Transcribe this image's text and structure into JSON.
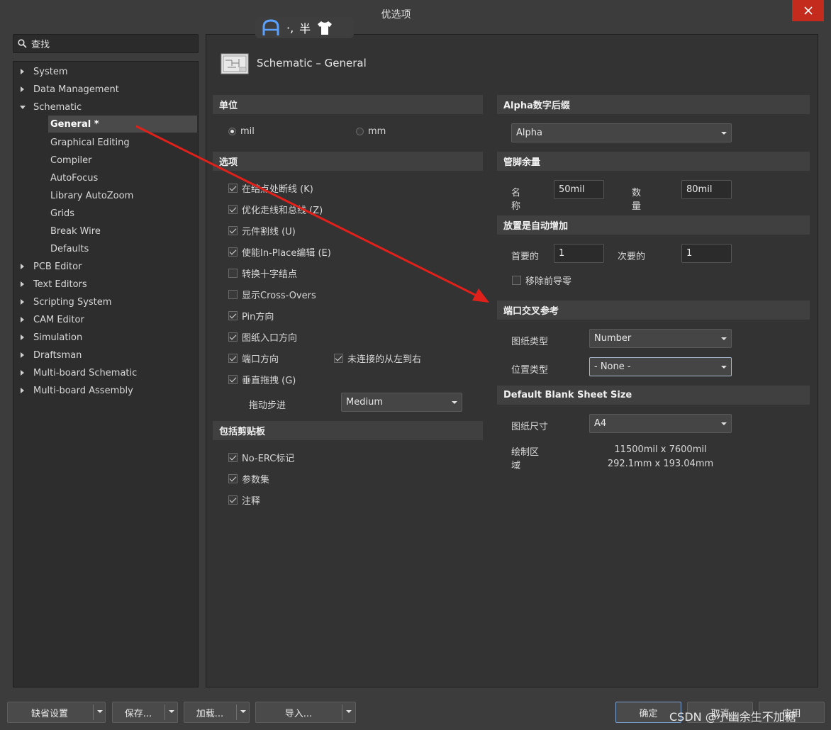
{
  "window": {
    "title": "优选项"
  },
  "ime": {
    "text1": "·,",
    "text2": "半"
  },
  "search": {
    "placeholder": "查找"
  },
  "tree": {
    "items": [
      {
        "label": "System"
      },
      {
        "label": "Data Management"
      },
      {
        "label": "Schematic"
      },
      {
        "label": "General *"
      },
      {
        "label": "Graphical Editing"
      },
      {
        "label": "Compiler"
      },
      {
        "label": "AutoFocus"
      },
      {
        "label": "Library AutoZoom"
      },
      {
        "label": "Grids"
      },
      {
        "label": "Break Wire"
      },
      {
        "label": "Defaults"
      },
      {
        "label": "PCB Editor"
      },
      {
        "label": "Text Editors"
      },
      {
        "label": "Scripting System"
      },
      {
        "label": "CAM Editor"
      },
      {
        "label": "Simulation"
      },
      {
        "label": "Draftsman"
      },
      {
        "label": "Multi-board Schematic"
      },
      {
        "label": "Multi-board Assembly"
      }
    ]
  },
  "page": {
    "title": "Schematic – General"
  },
  "units": {
    "header": "单位",
    "mil": "mil",
    "mm": "mm",
    "selected": "mil"
  },
  "options": {
    "header": "选项",
    "items": [
      {
        "label": "在结点处断线 (K)",
        "checked": true
      },
      {
        "label": "优化走线和总线 (Z)",
        "checked": true
      },
      {
        "label": "元件割线 (U)",
        "checked": true
      },
      {
        "label": "使能In-Place编辑 (E)",
        "checked": true
      },
      {
        "label": "转换十字结点",
        "checked": false
      },
      {
        "label": "显示Cross-Overs",
        "checked": false
      },
      {
        "label": "Pin方向",
        "checked": true
      },
      {
        "label": "图纸入口方向",
        "checked": true
      },
      {
        "label": "端口方向",
        "checked": true
      },
      {
        "label": "垂直拖拽 (G)",
        "checked": true
      }
    ],
    "unconnected_label": "未连接的从左到右",
    "unconnected_checked": true,
    "drag_step_label": "拖动步进",
    "drag_step_value": "Medium"
  },
  "clipboard": {
    "header": "包括剪贴板",
    "items": [
      {
        "label": "No-ERC标记",
        "checked": true
      },
      {
        "label": "参数集",
        "checked": true
      },
      {
        "label": "注释",
        "checked": true
      }
    ]
  },
  "alpha": {
    "header": "Alpha数字后缀",
    "value": "Alpha"
  },
  "pin_margin": {
    "header": "管脚余量",
    "name_label_1": "名",
    "name_label_2": "称",
    "name_value": "50mil",
    "number_label_1": "数",
    "number_label_2": "量",
    "number_value": "80mil"
  },
  "auto_increment": {
    "header": "放置是自动增加",
    "primary_label": "首要的",
    "primary_value": "1",
    "secondary_label": "次要的",
    "secondary_value": "1",
    "remove_zeros_label": "移除前导零",
    "remove_zeros_checked": false
  },
  "port_cross_ref": {
    "header": "端口交叉参考",
    "sheet_type_label": "图纸类型",
    "sheet_type_value": "Number",
    "location_type_label": "位置类型",
    "location_type_value": "- None -"
  },
  "blank_sheet": {
    "header": "Default Blank Sheet Size",
    "sheet_size_label": "图纸尺寸",
    "sheet_size_value": "A4",
    "draw_area_label_1": "绘制区",
    "draw_area_label_2": "域",
    "draw_area_mil": "11500mil x 7600mil",
    "draw_area_mm": "292.1mm x 193.04mm"
  },
  "footer": {
    "defaults": "缺省设置",
    "save": "保存...",
    "load": "加载...",
    "import": "导入...",
    "ok": "确定",
    "cancel": "取消",
    "apply": "应用",
    "watermark": "CSDN @小幽余生不加糖"
  },
  "colors": {
    "arrow": "#e0201a",
    "close": "#c42b1c"
  }
}
